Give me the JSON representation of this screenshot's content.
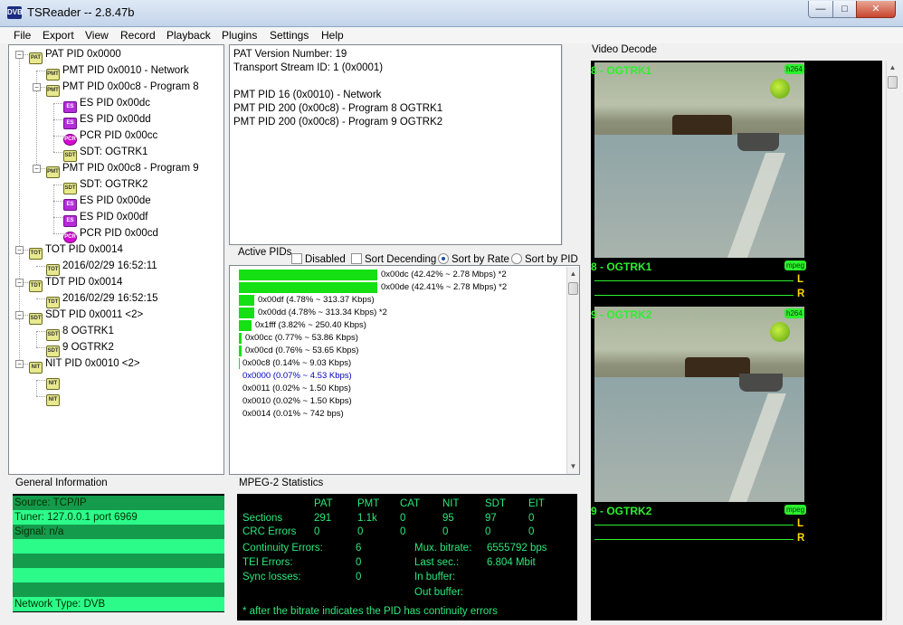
{
  "window": {
    "title": "TSReader -- 2.8.47b",
    "app_icon": "DVB"
  },
  "menu": [
    "File",
    "Export",
    "View",
    "Record",
    "Playback",
    "Plugins",
    "Settings",
    "Help"
  ],
  "tree": [
    {
      "label": "PAT PID 0x0000",
      "icon": "PAT"
    },
    {
      "label": "PMT PID 0x0010 - Network",
      "icon": "PMT"
    },
    {
      "label": "PMT PID 0x00c8 - Program 8",
      "icon": "PMT"
    },
    {
      "label": "ES PID 0x00dc",
      "icon": "ES"
    },
    {
      "label": "ES PID 0x00dd",
      "icon": "ES"
    },
    {
      "label": "PCR PID 0x00cc",
      "icon": "PCR"
    },
    {
      "label": "SDT: OGTRK1",
      "icon": "SDT"
    },
    {
      "label": "PMT PID 0x00c8 - Program 9",
      "icon": "PMT"
    },
    {
      "label": "SDT: OGTRK2",
      "icon": "SDT"
    },
    {
      "label": "ES PID 0x00de",
      "icon": "ES"
    },
    {
      "label": "ES PID 0x00df",
      "icon": "ES"
    },
    {
      "label": "PCR PID 0x00cd",
      "icon": "PCR"
    },
    {
      "label": "TOT PID 0x0014",
      "icon": "TOT"
    },
    {
      "label": "2016/02/29 16:52:11",
      "icon": "TOT"
    },
    {
      "label": "TDT PID 0x0014",
      "icon": "TDT"
    },
    {
      "label": "2016/02/29 16:52:15",
      "icon": "TDT"
    },
    {
      "label": "SDT PID 0x0011 <2>",
      "icon": "SDT"
    },
    {
      "label": "8 OGTRK1",
      "icon": "SDT"
    },
    {
      "label": "9 OGTRK2",
      "icon": "SDT"
    },
    {
      "label": "NIT PID 0x0010 <2>",
      "icon": "NIT"
    },
    {
      "label": "",
      "icon": "NIT"
    },
    {
      "label": "",
      "icon": "NIT"
    }
  ],
  "pat_info": [
    "PAT Version Number: 19",
    "Transport Stream ID: 1 (0x0001)",
    "",
    "PMT PID 16 (0x0010) - Network",
    "PMT PID 200 (0x00c8) - Program 8 OGTRK1",
    "PMT PID 200 (0x00c8) - Program 9 OGTRK2"
  ],
  "active_pids": {
    "label": "Active PIDs",
    "options": {
      "disabled": "Disabled",
      "sort_descending": "Sort Decending",
      "sort_by_rate": "Sort by Rate",
      "sort_by_pid": "Sort by PID",
      "selected": "sort_by_rate"
    },
    "rows": [
      {
        "text": "0x00dc (42.42% ~ 2.78 Mbps) *2",
        "share": 0.4242,
        "highlight": false
      },
      {
        "text": "0x00de (42.41% ~ 2.78 Mbps) *2",
        "share": 0.4241,
        "highlight": false
      },
      {
        "text": "0x00df (4.78% ~ 313.37 Kbps)",
        "share": 0.0478,
        "highlight": false
      },
      {
        "text": "0x00dd (4.78% ~ 313.34 Kbps) *2",
        "share": 0.0478,
        "highlight": false
      },
      {
        "text": "0x1fff (3.82% ~ 250.40 Kbps)",
        "share": 0.0382,
        "highlight": false
      },
      {
        "text": "0x00cc (0.77% ~ 53.86 Kbps)",
        "share": 0.0077,
        "highlight": false
      },
      {
        "text": "0x00cd (0.76% ~ 53.65 Kbps)",
        "share": 0.0076,
        "highlight": false
      },
      {
        "text": "0x00c8 (0.14% ~ 9.03 Kbps)",
        "share": 0.0014,
        "highlight": false
      },
      {
        "text": "0x0000 (0.07% ~ 4.53 Kbps)",
        "share": 0.0007,
        "highlight": true
      },
      {
        "text": "0x0011 (0.02% ~ 1.50 Kbps)",
        "share": 0.0002,
        "highlight": false
      },
      {
        "text": "0x0010 (0.02% ~ 1.50 Kbps)",
        "share": 0.0002,
        "highlight": false
      },
      {
        "text": "0x0014 (0.01% ~ 742 bps)",
        "share": 0.0001,
        "highlight": false
      }
    ]
  },
  "general_info": {
    "label": "General Information",
    "rows": [
      "Source: TCP/IP",
      "Tuner: 127.0.0.1 port 6969",
      "Signal: n/a",
      "",
      "",
      "",
      "",
      "Network Type: DVB"
    ]
  },
  "mpeg_stats": {
    "label": "MPEG-2 Statistics",
    "headers": [
      "PAT",
      "PMT",
      "CAT",
      "NIT",
      "SDT",
      "EIT"
    ],
    "sections_label": "Sections",
    "sections": [
      "291",
      "1.1k",
      "0",
      "95",
      "97",
      "0"
    ],
    "crc_label": "CRC Errors",
    "crc": [
      "0",
      "0",
      "0",
      "0",
      "0",
      "0"
    ],
    "continuity_label": "Continuity Errors:",
    "continuity": "6",
    "tei_label": "TEI Errors:",
    "tei": "0",
    "sync_label": "Sync losses:",
    "sync": "0",
    "mux_label": "Mux. bitrate:",
    "mux": "6555792 bps",
    "last_label": "Last sec.:",
    "last": "6.804 Mbit",
    "inbuf_label": "In buffer:",
    "outbuf_label": "Out buffer:",
    "footnote": "* after the bitrate indicates the PID has continuity errors"
  },
  "video_decode": {
    "label": "Video Decode",
    "ch1_video_title": "8 - OGTRK1",
    "ch1_video_codec": "h264",
    "ch1_audio_title": "8 - OGTRK1",
    "ch1_audio_codec": "mpeg",
    "ch2_video_title": "9 - OGTRK2",
    "ch2_video_codec": "h264",
    "ch2_audio_title": "9 - OGTRK2",
    "ch2_audio_codec": "mpeg",
    "left": "L",
    "right": "R"
  },
  "colors": {
    "accent_green": "#2cf02c",
    "bar_green": "#14e014",
    "info_light": "#2cfb8a",
    "info_dark": "#149b4c",
    "audio_yellow": "#ffd800",
    "highlight_blue": "#0000c0"
  }
}
